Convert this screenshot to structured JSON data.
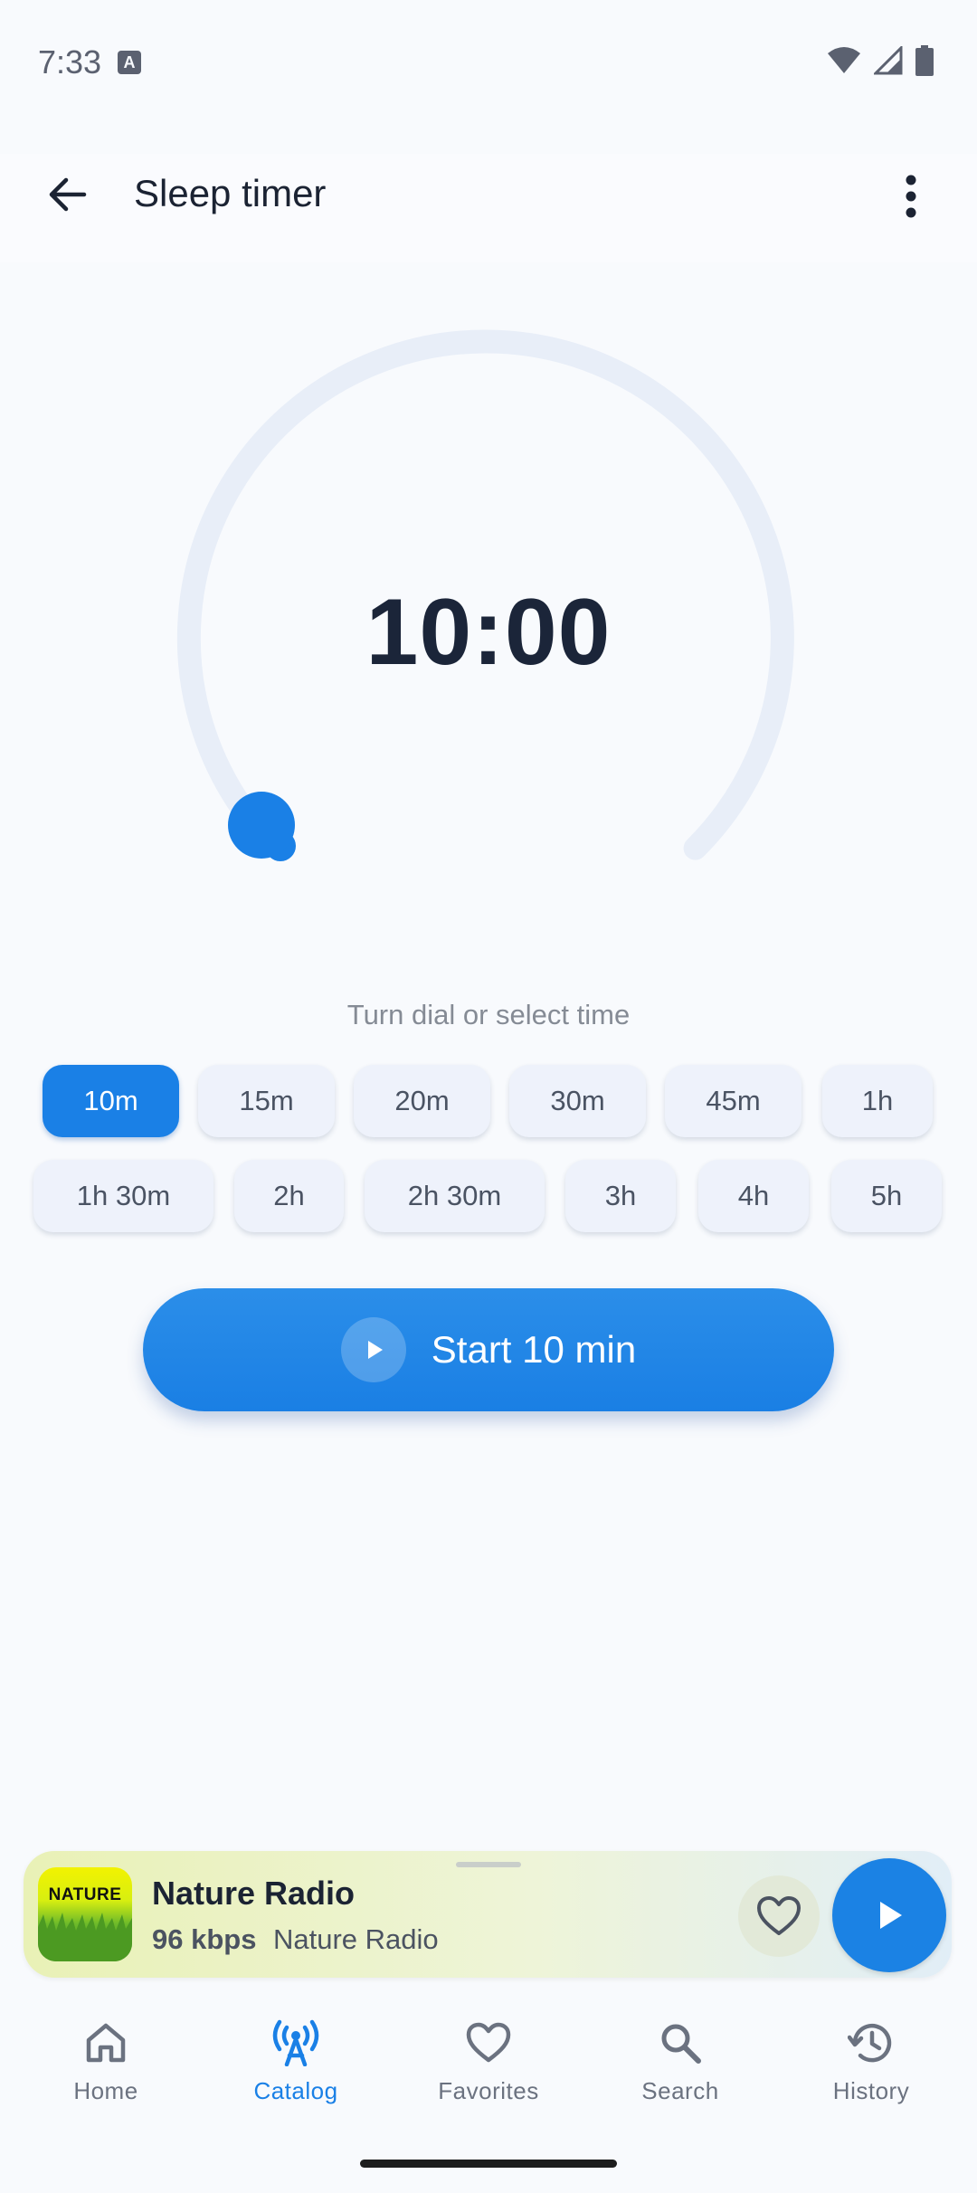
{
  "status_bar": {
    "time": "7:33",
    "notification_icon": "keyboard-a-icon",
    "icons": [
      "wifi-icon",
      "signal-icon",
      "battery-icon"
    ]
  },
  "app_bar": {
    "title": "Sleep timer",
    "back_icon": "arrow-back-icon",
    "menu_icon": "more-vert-icon"
  },
  "dial": {
    "time_display": "10:00",
    "progress": 0.0
  },
  "hint": "Turn dial or select time",
  "presets": [
    {
      "label": "10m",
      "selected": true
    },
    {
      "label": "15m",
      "selected": false
    },
    {
      "label": "20m",
      "selected": false
    },
    {
      "label": "30m",
      "selected": false
    },
    {
      "label": "45m",
      "selected": false
    },
    {
      "label": "1h",
      "selected": false
    },
    {
      "label": "1h 30m",
      "selected": false
    },
    {
      "label": "2h",
      "selected": false
    },
    {
      "label": "2h 30m",
      "selected": false
    },
    {
      "label": "3h",
      "selected": false
    },
    {
      "label": "4h",
      "selected": false
    },
    {
      "label": "5h",
      "selected": false
    }
  ],
  "start_button": {
    "label": "Start 10 min",
    "icon": "play-icon"
  },
  "mini_player": {
    "art_label": "NATURE",
    "station_name": "Nature Radio",
    "bitrate": "96 kbps",
    "subtitle": "Nature Radio",
    "favorite_icon": "heart-outline-icon",
    "play_icon": "play-icon"
  },
  "bottom_nav": [
    {
      "label": "Home",
      "icon": "home-icon",
      "active": false
    },
    {
      "label": "Catalog",
      "icon": "radio-tower-icon",
      "active": true
    },
    {
      "label": "Favorites",
      "icon": "heart-outline-icon",
      "active": false
    },
    {
      "label": "Search",
      "icon": "search-icon",
      "active": false
    },
    {
      "label": "History",
      "icon": "history-icon",
      "active": false
    }
  ],
  "colors": {
    "accent": "#1a80e6",
    "dial_track": "#e8eef8",
    "text_primary": "#1b2539"
  }
}
